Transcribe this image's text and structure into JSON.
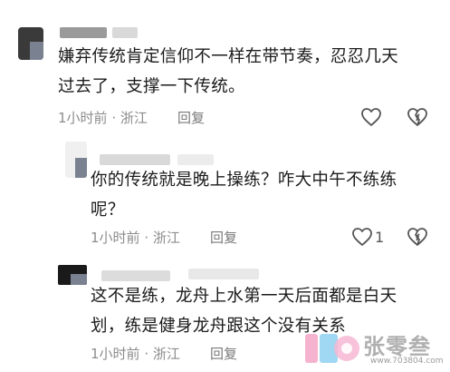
{
  "comments": [
    {
      "text_line1": "嫌弃传统肯定信仰不一样在带节奏，忍忍几天",
      "text_line2": "过去了，支撑一下传统。",
      "time": "1小时前",
      "location": "浙江",
      "reply": "回复",
      "likes": ""
    },
    {
      "text_line1": "你的传统就是晚上操练？咋大中午不练练",
      "text_line2": "呢？",
      "time": "1小时前",
      "location": "浙江",
      "reply": "回复",
      "likes": "1"
    },
    {
      "text_line1": "这不是练，龙舟上水第一天后面都是白天",
      "text_line2": "划，练是健身龙舟跟这个没有关系",
      "time": "1小时前",
      "location": "浙江",
      "reply": "回复",
      "likes": ""
    }
  ],
  "separator": "·",
  "icons": {
    "like": "heart-outline-icon",
    "dislike": "broken-heart-icon"
  },
  "watermark": {
    "brand": "张零叁",
    "url": "www.703804.com"
  },
  "colors": {
    "text": "#1b1b1b",
    "meta": "#8c8c8c",
    "icon": "#555555"
  }
}
